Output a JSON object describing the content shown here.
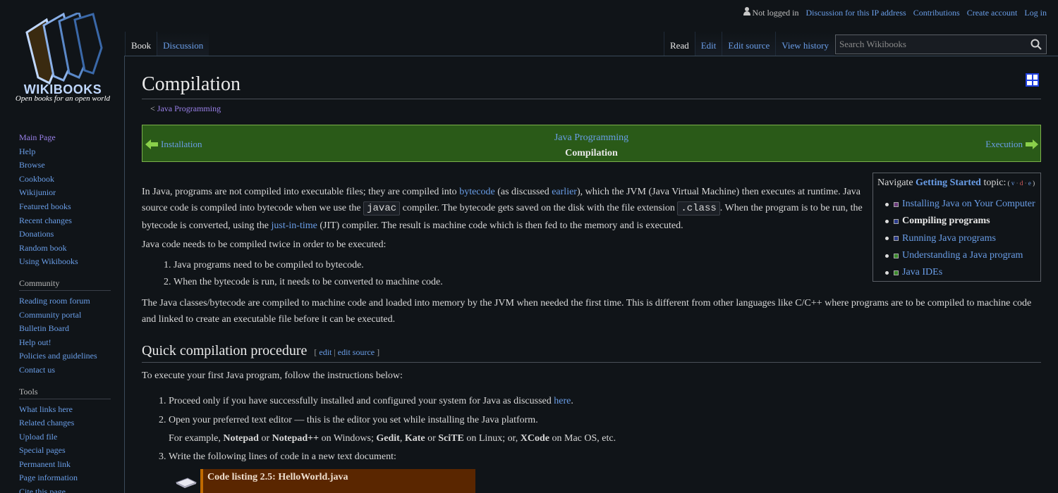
{
  "personal": {
    "not_logged_in": "Not logged in",
    "talk": "Discussion for this IP address",
    "contributions": "Contributions",
    "create_account": "Create account",
    "login": "Log in"
  },
  "logo": {
    "wordmark": "WIKIBOOKS",
    "tagline": "Open books for an open world"
  },
  "sidebar": {
    "nav": [
      "Main Page",
      "Help",
      "Browse",
      "Cookbook",
      "Wikijunior",
      "Featured books",
      "Recent changes",
      "Donations",
      "Random book",
      "Using Wikibooks"
    ],
    "community_title": "Community",
    "community": [
      "Reading room forum",
      "Community portal",
      "Bulletin Board",
      "Help out!",
      "Policies and guidelines",
      "Contact us"
    ],
    "tools_title": "Tools",
    "tools": [
      "What links here",
      "Related changes",
      "Upload file",
      "Special pages",
      "Permanent link",
      "Page information",
      "Cite this page"
    ]
  },
  "tabs": {
    "book": "Book",
    "discussion": "Discussion",
    "read": "Read",
    "edit": "Edit",
    "edit_source": "Edit source",
    "view_history": "View history"
  },
  "search": {
    "placeholder": "Search Wikibooks"
  },
  "page": {
    "title": "Compilation",
    "breadcrumb_prefix": "< ",
    "breadcrumb": "Java Programming"
  },
  "bookbar": {
    "prev": "Installation",
    "book": "Java Programming",
    "current": "Compilation",
    "next": "Execution"
  },
  "navbox": {
    "prefix": "Navigate ",
    "topic": "Getting Started",
    "suffix": " topic:",
    "vde_open": " ( ",
    "v": "v",
    "d": "d",
    "e": "e",
    "vde_close": " )",
    "items": [
      {
        "label": "Installing Java on Your Computer",
        "current": false
      },
      {
        "label": "Compiling programs",
        "current": true
      },
      {
        "label": "Running Java programs",
        "current": false
      },
      {
        "label": "Understanding a Java program",
        "current": false
      },
      {
        "label": "Java IDEs",
        "current": false
      }
    ]
  },
  "content": {
    "p1_a": "In Java, programs are not compiled into executable files; they are compiled into ",
    "p1_bytecode": "bytecode",
    "p1_b": " (as discussed ",
    "p1_earlier": "earlier",
    "p1_c": "), which the JVM (Java Virtual Machine) then executes at runtime. Java source code is compiled into bytecode when we use the ",
    "p1_javac": "javac",
    "p1_d": " compiler. The bytecode gets saved on the disk with the file extension ",
    "p1_class": ".class",
    "p1_e": ". When the program is to be run, the bytecode is converted, using the ",
    "p1_jit": "just-in-time",
    "p1_f": " (JIT) compiler. The result is machine code which is then fed to the memory and is executed.",
    "p2": "Java code needs to be compiled twice in order to be executed:",
    "list1": [
      "Java programs need to be compiled to bytecode.",
      "When the bytecode is run, it needs to be converted to machine code."
    ],
    "p3": "The Java classes/bytecode are compiled to machine code and loaded into memory by the JVM when needed the first time. This is different from other languages like C/C++ where programs are to be compiled to machine code and linked to create an executable file before it can be executed.",
    "h2": "Quick compilation procedure",
    "h2_edit_open": "[ ",
    "h2_edit": "edit",
    "h2_sep": " | ",
    "h2_edit_source": "edit source",
    "h2_edit_close": " ]",
    "p4": "To execute your first Java program, follow the instructions below:",
    "step1_a": "Proceed only if you have successfully installed and configured your system for Java as discussed ",
    "step1_here": "here",
    "step1_b": ".",
    "step2": "Open your preferred text editor — this is the editor you set while installing the Java platform.",
    "step2_sub_a": "For example, ",
    "step2_notepad": "Notepad",
    "step2_or1": " or ",
    "step2_notepadpp": "Notepad++",
    "step2_sub_b": " on Windows; ",
    "step2_gedit": "Gedit",
    "step2_comma": ", ",
    "step2_kate": "Kate",
    "step2_or2": " or ",
    "step2_scite": "SciTE",
    "step2_sub_c": " on Linux; or, ",
    "step2_xcode": "XCode",
    "step2_sub_d": " on Mac OS, etc.",
    "step3": "Write the following lines of code in a new text document:",
    "code_caption": "Code listing 2.5: HelloWorld.java"
  }
}
